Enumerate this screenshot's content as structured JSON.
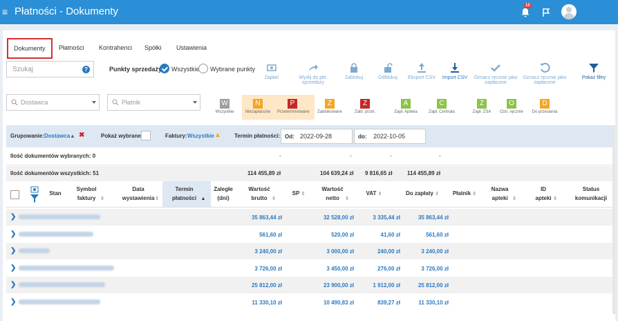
{
  "app": {
    "title": "Płatności - Dokumenty",
    "notif_count": "12"
  },
  "tabs": [
    "Dokumenty",
    "Płatności",
    "Kontrahenci",
    "Spółki",
    "Ustawienia"
  ],
  "search": {
    "placeholder": "Szukaj"
  },
  "points": {
    "label": "Punkty sprzedaży:",
    "opt_all": "Wszystkie",
    "opt_sel": "Wybrane punkty"
  },
  "toolbar": {
    "pay": "Zapłać",
    "send": "Wyślij do pkt. sprzedaży",
    "lock": "Zablokuj",
    "unlock": "Odblokuj",
    "export": "Eksport CSV",
    "import": "Import CSV",
    "mark_paid": "Oznacz ręcznie jako zapłacone",
    "mark_unpaid": "Oznacz ręcznie jako zapłacone",
    "filters": "Pokaż filtry"
  },
  "filters": {
    "dostawca": "Dostawca",
    "platnik": "Płatnik"
  },
  "status_filters": [
    {
      "letter": "W",
      "label": "Wszystkie",
      "color": "#9e9e9e"
    },
    {
      "letter": "N",
      "label": "Niezapłacone",
      "color": "#f5a623"
    },
    {
      "letter": "P",
      "label": "Przeterminowane",
      "color": "#c62828"
    },
    {
      "letter": "Z",
      "label": "Zablokowane",
      "color": "#f5a623"
    },
    {
      "letter": "Z",
      "label": "Zabl. przet.",
      "color": "#c62828"
    },
    {
      "letter": "A",
      "label": "Zapł. Apteka",
      "color": "#8bc34a"
    },
    {
      "letter": "C",
      "label": "Zapł. Centrala",
      "color": "#8bc34a"
    },
    {
      "letter": "Z",
      "label": "Zapł. ZSA",
      "color": "#8bc34a"
    },
    {
      "letter": "O",
      "label": "Ozn. ręcznie",
      "color": "#8bc34a"
    },
    {
      "letter": "D",
      "label": "Do przeslania",
      "color": "#f5a623"
    }
  ],
  "grouping": {
    "label": "Grupowanie:",
    "value": "Dostawca",
    "show_selected": "Pokaż wybrane",
    "invoices_label": "Faktury:",
    "invoices_value": "Wszystkie",
    "term_label": "Termin płatności:",
    "from_label": "Od:",
    "from": "2022-09-28",
    "to_label": "do:",
    "to": "2022-10-05"
  },
  "summary": {
    "selected_label": "Ilość dokumentów wybranych: 0",
    "sel_vals": [
      "-",
      "-",
      "-",
      "-"
    ],
    "all_label": "Ilość dokumentów wszystkich: 51",
    "brutto": "114 455,89 zł",
    "netto": "104 639,24 zł",
    "vat": "9 816,65 zł",
    "do_zaplaty": "114 455,89 zł"
  },
  "columns": {
    "stan": "Stan",
    "symbol": "Symbol faktury",
    "data": "Data wystawienia",
    "termin": "Termin płatności",
    "zalegle": "Zaległe (dni)",
    "brutto": "Wartość brutto",
    "sp": "SP",
    "netto": "Wartość netto",
    "vat": "VAT",
    "do_zaplaty": "Do zapłaty",
    "platnik": "Płatnik",
    "nazwa": "Nazwa apteki",
    "id": "ID apteki",
    "status": "Status komunikacji"
  },
  "rows": [
    {
      "brutto": "35 863,44 zł",
      "netto": "32 528,00 zł",
      "vat": "3 335,44 zł",
      "pay": "35 863,44 zł"
    },
    {
      "brutto": "561,60 zł",
      "netto": "520,00 zł",
      "vat": "41,60 zł",
      "pay": "561,60 zł"
    },
    {
      "brutto": "3 240,00 zł",
      "netto": "3 000,00 zł",
      "vat": "240,00 zł",
      "pay": "3 240,00 zł"
    },
    {
      "brutto": "3 726,00 zł",
      "netto": "3 450,00 zł",
      "vat": "276,00 zł",
      "pay": "3 726,00 zł"
    },
    {
      "brutto": "25 812,00 zł",
      "netto": "23 900,00 zł",
      "vat": "1 912,00 zł",
      "pay": "25 812,00 zł"
    },
    {
      "brutto": "11 330,10 zł",
      "netto": "10 490,83 zł",
      "vat": "839,27 zł",
      "pay": "11 330,10 zł"
    }
  ]
}
